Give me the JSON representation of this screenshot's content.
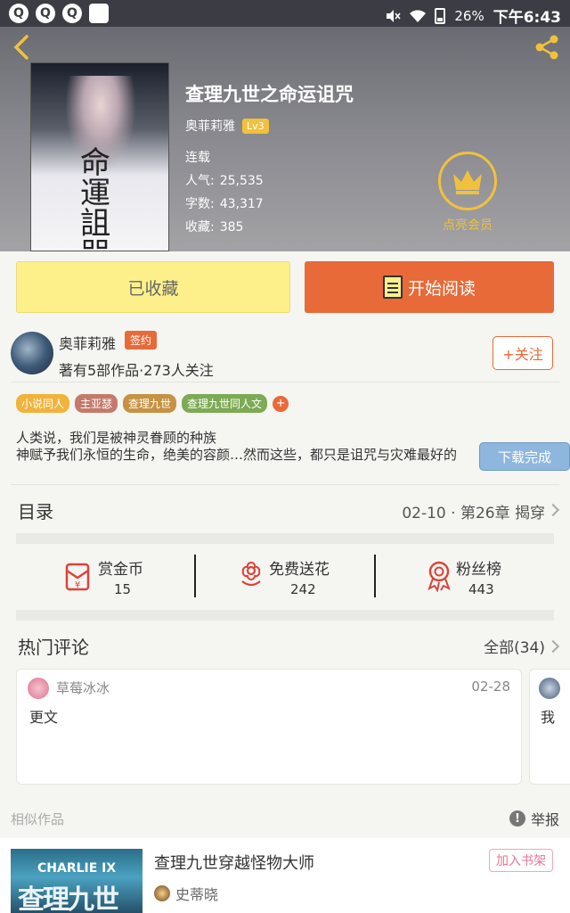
{
  "status_bar": {
    "battery": "26%",
    "time": "下午6:43"
  },
  "book": {
    "title": "查理九世之命运诅咒",
    "author": "奥菲莉雅",
    "level": "Lv3",
    "status": "连载",
    "stats": [
      {
        "label": "人气:",
        "value": "25,535"
      },
      {
        "label": "字数:",
        "value": "43,317"
      },
      {
        "label": "收藏:",
        "value": "385"
      }
    ],
    "vip_label": "点亮会员",
    "cover_title": [
      "命",
      "運",
      "詛",
      "咒"
    ]
  },
  "actions": {
    "favorited_label": "已收藏",
    "read_label": "开始阅读"
  },
  "author_section": {
    "name": "奥菲莉雅",
    "badge": "签约",
    "meta": "著有5部作品·273人关注",
    "follow_label": "+关注",
    "tags": [
      {
        "label": "小说同人",
        "color": "#f0b33b"
      },
      {
        "label": "主亚瑟",
        "color": "#c47a6b"
      },
      {
        "label": "查理九世",
        "color": "#c69243"
      },
      {
        "label": "查理九世同人文",
        "color": "#7daa55"
      }
    ],
    "add_tag": "+",
    "description": [
      "人类说，我们是被神灵眷顾的种族",
      "神赋予我们永恒的生命，绝美的容颜…然而这些，都只是诅咒与灾难最好的"
    ],
    "toast": "下载完成"
  },
  "catalog": {
    "title": "目录",
    "latest": "02-10 · 第26章 揭穿"
  },
  "stat_row": [
    {
      "name": "赏金币",
      "value": "15"
    },
    {
      "name": "免费送花",
      "value": "242"
    },
    {
      "name": "粉丝榜",
      "value": "443"
    }
  ],
  "hot_comments": {
    "title": "热门评论",
    "all_label": "全部(34)",
    "comments": [
      {
        "user": "草莓冰冰",
        "date": "02-28",
        "text": "更文"
      },
      {
        "user": "",
        "date": "",
        "text": "我"
      }
    ]
  },
  "similar": {
    "label": "相似作品",
    "report": "举报",
    "items": [
      {
        "title": "查理九世穿越怪物大师",
        "author": "史蒂晓",
        "add_label": "加入书架",
        "cover_title": "查理九世",
        "cover_sub": "CHARLIE IX"
      }
    ]
  },
  "colors": {
    "accent": "#e86a38",
    "fav": "#fdf08b",
    "gold": "#f0c13c"
  }
}
